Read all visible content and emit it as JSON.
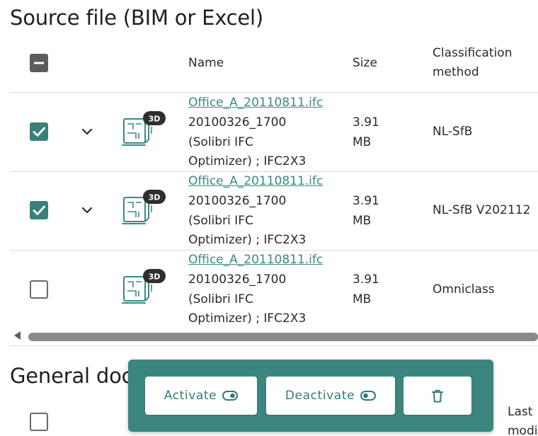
{
  "section1": {
    "title": "Source file (BIM or Excel)"
  },
  "columns": {
    "name": "Name",
    "size": "Size",
    "classification_line1": "Classification",
    "classification_line2": "method"
  },
  "rows": [
    {
      "checked": true,
      "expandable": true,
      "badge": "3D",
      "filename": "Office_A_20110811.ifc",
      "desc_line1": "20100326_1700",
      "desc_line2": "(Solibri IFC",
      "desc_line3": "Optimizer) ; IFC2X3",
      "size_line1": "3.91",
      "size_line2": "MB",
      "classification": "NL-SfB"
    },
    {
      "checked": true,
      "expandable": true,
      "badge": "3D",
      "filename": "Office_A_20110811.ifc",
      "desc_line1": "20100326_1700",
      "desc_line2": "(Solibri IFC",
      "desc_line3": "Optimizer) ; IFC2X3",
      "size_line1": "3.91",
      "size_line2": "MB",
      "classification": "NL-SfB V202112"
    },
    {
      "checked": false,
      "expandable": false,
      "badge": "3D",
      "filename": "Office_A_20110811.ifc",
      "desc_line1": "20100326_1700",
      "desc_line2": "(Solibri IFC",
      "desc_line3": "Optimizer) ; IFC2X3",
      "size_line1": "3.91",
      "size_line2": "MB",
      "classification": "Omniclass"
    }
  ],
  "section2": {
    "title": "General documents",
    "last_modified_line1": "Last",
    "last_modified_line2": "modi"
  },
  "toolbar": {
    "activate_label": "Activate",
    "deactivate_label": "Deactivate",
    "delete_icon": "trash-icon"
  },
  "colors": {
    "accent": "#3a7f7a",
    "toolbar_bg": "#3c857f",
    "link": "#3a8a84"
  }
}
